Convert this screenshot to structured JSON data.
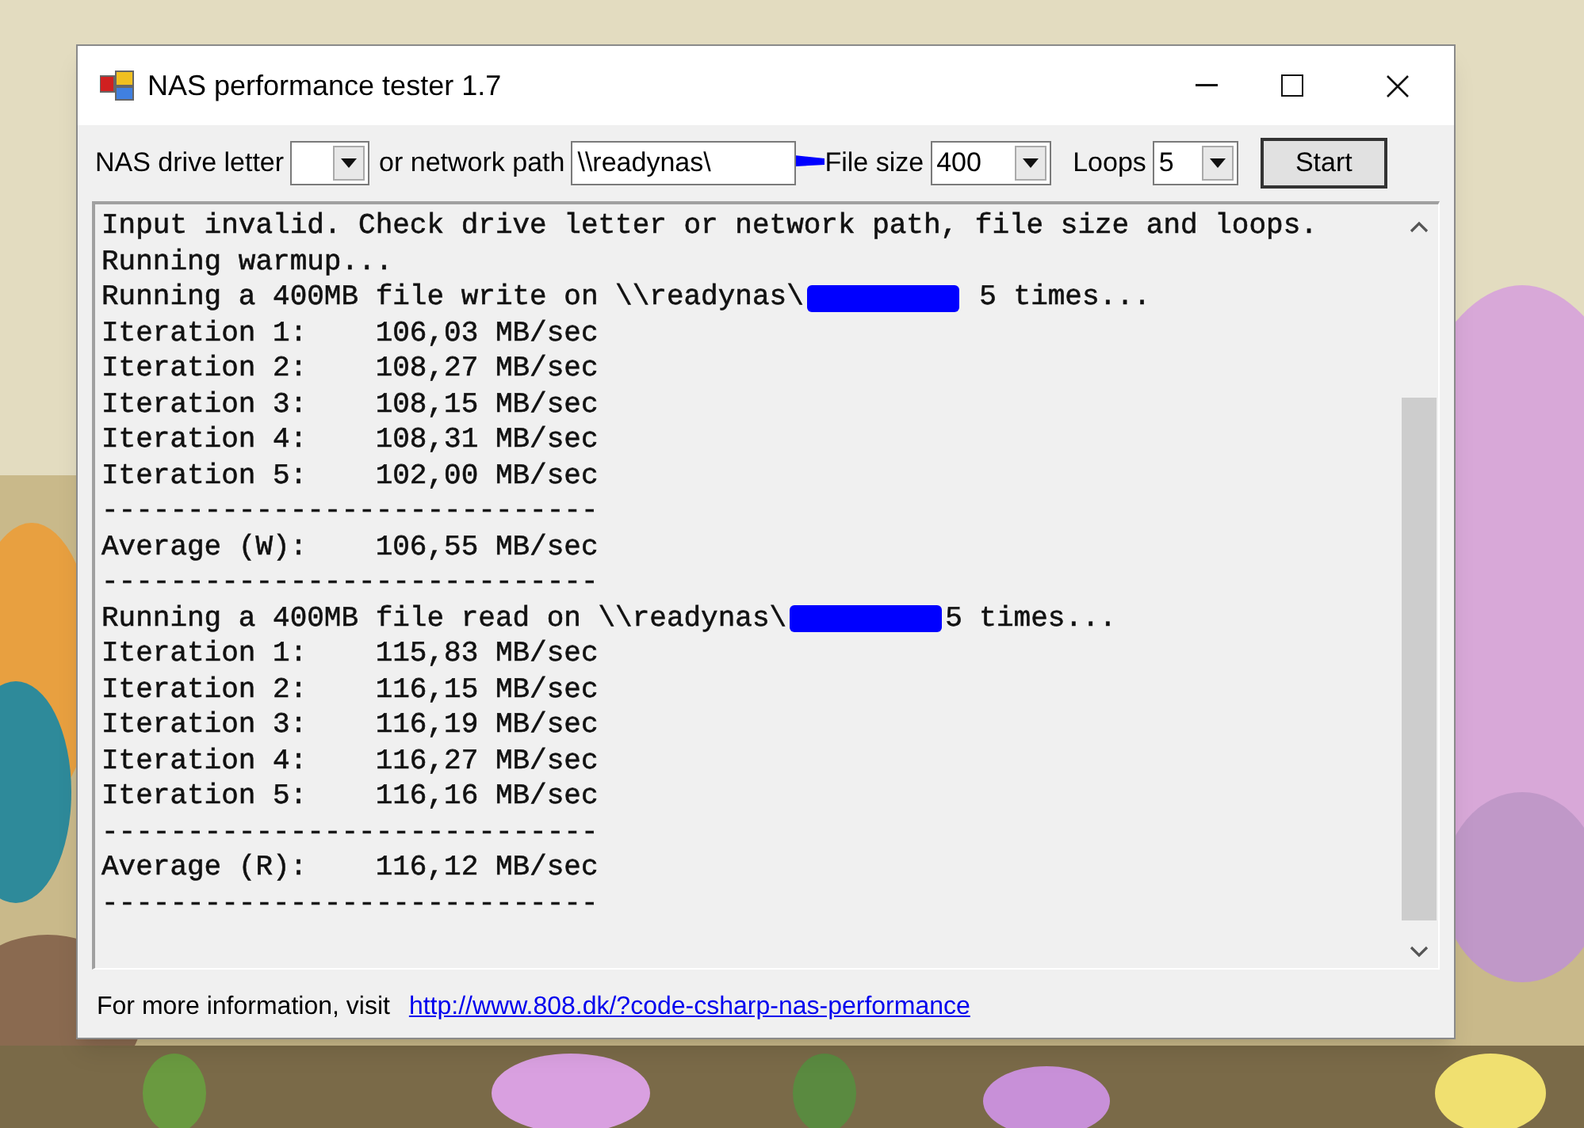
{
  "window": {
    "title": "NAS performance tester 1.7"
  },
  "toolbar": {
    "drive_label": "NAS drive letter",
    "path_label": "or network path",
    "path_value": "\\\\readynas\\",
    "size_label": "File size",
    "size_value": "400",
    "loops_label": "Loops",
    "loops_value": "5",
    "start_button": "Start"
  },
  "output": [
    {
      "kind": "plain",
      "text": "Input invalid. Check drive letter or network path, file size and loops."
    },
    {
      "kind": "plain",
      "text": "Running warmup..."
    },
    {
      "kind": "redacted",
      "before": "Running a 400MB file write on \\\\readynas\\",
      "after": " 5 times..."
    },
    {
      "kind": "plain",
      "text": "Iteration 1:    106,03 MB/sec"
    },
    {
      "kind": "plain",
      "text": "Iteration 2:    108,27 MB/sec"
    },
    {
      "kind": "plain",
      "text": "Iteration 3:    108,15 MB/sec"
    },
    {
      "kind": "plain",
      "text": "Iteration 4:    108,31 MB/sec"
    },
    {
      "kind": "plain",
      "text": "Iteration 5:    102,00 MB/sec"
    },
    {
      "kind": "plain",
      "text": "-----------------------------"
    },
    {
      "kind": "plain",
      "text": "Average (W):    106,55 MB/sec"
    },
    {
      "kind": "plain",
      "text": "-----------------------------"
    },
    {
      "kind": "redacted",
      "before": "Running a 400MB file read on \\\\readynas\\",
      "after": "5 times..."
    },
    {
      "kind": "plain",
      "text": "Iteration 1:    115,83 MB/sec"
    },
    {
      "kind": "plain",
      "text": "Iteration 2:    116,15 MB/sec"
    },
    {
      "kind": "plain",
      "text": "Iteration 3:    116,19 MB/sec"
    },
    {
      "kind": "plain",
      "text": "Iteration 4:    116,27 MB/sec"
    },
    {
      "kind": "plain",
      "text": "Iteration 5:    116,16 MB/sec"
    },
    {
      "kind": "plain",
      "text": "-----------------------------"
    },
    {
      "kind": "plain",
      "text": "Average (R):    116,12 MB/sec"
    },
    {
      "kind": "plain",
      "text": "-----------------------------"
    }
  ],
  "footer": {
    "text": "For more information, visit",
    "link": "http://www.808.dk/?code-csharp-nas-performance"
  }
}
